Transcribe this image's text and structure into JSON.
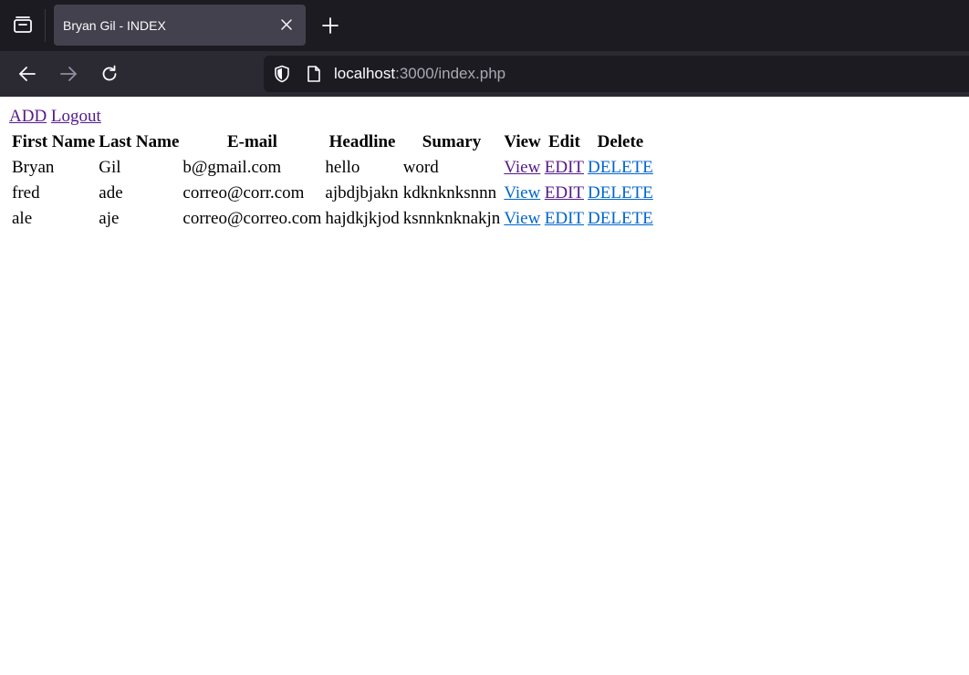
{
  "browser": {
    "tab_title": "Bryan Gil - INDEX",
    "url_host": "localhost",
    "url_rest": ":3000/index.php",
    "icons": {
      "tab_list": "tab-list-icon",
      "close": "close-icon",
      "new_tab": "plus-icon",
      "back": "arrow-left-icon",
      "forward": "arrow-right-icon",
      "reload": "reload-icon",
      "shield": "shield-icon",
      "page": "page-icon"
    }
  },
  "page": {
    "links": {
      "add": "ADD",
      "logout": "Logout"
    },
    "table": {
      "headers": [
        "First Name",
        "Last Name",
        "E-mail",
        "Headline",
        "Sumary",
        "View",
        "Edit",
        "Delete"
      ],
      "rows": [
        {
          "first": "Bryan",
          "last": "Gil",
          "email": "b@gmail.com",
          "headline": "hello",
          "summary": "word",
          "view": "View",
          "edit": "EDIT",
          "delete": "DELETE"
        },
        {
          "first": "fred",
          "last": "ade",
          "email": "correo@corr.com",
          "headline": "ajbdjbjakn",
          "summary": "kdknknksnnn",
          "view": "View",
          "edit": "EDIT",
          "delete": "DELETE"
        },
        {
          "first": "ale",
          "last": "aje",
          "email": "correo@correo.com",
          "headline": "hajdkjkjod",
          "summary": "ksnnknknakjn",
          "view": "View",
          "edit": "EDIT",
          "delete": "DELETE"
        }
      ]
    },
    "colors": {
      "visited_link": "#551a8b",
      "unvisited_link": "#0066cc"
    }
  }
}
